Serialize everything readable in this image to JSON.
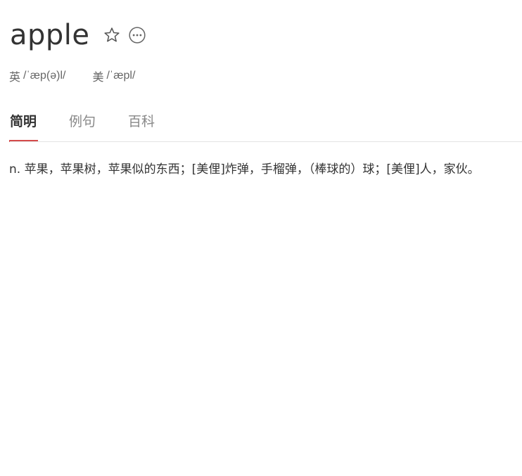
{
  "entry": {
    "word": "apple",
    "favorite_icon": "star-outline-icon",
    "more_icon": "more-circle-icon"
  },
  "phonetics": {
    "uk_label": "英",
    "uk_ipa": "/ˈæp(ə)l/",
    "us_label": "美",
    "us_ipa": "/ˈæpl/"
  },
  "tabs": [
    {
      "label": "简明",
      "active": true
    },
    {
      "label": "例句",
      "active": false
    },
    {
      "label": "百科",
      "active": false
    }
  ],
  "colors": {
    "accent": "#d44a4a",
    "text": "#333333",
    "muted": "#888888"
  },
  "definition": {
    "text": "n. 苹果，苹果树，苹果似的东西；[美俚]炸弹，手榴弹，（棒球的）球；[美俚]人，家伙。"
  }
}
